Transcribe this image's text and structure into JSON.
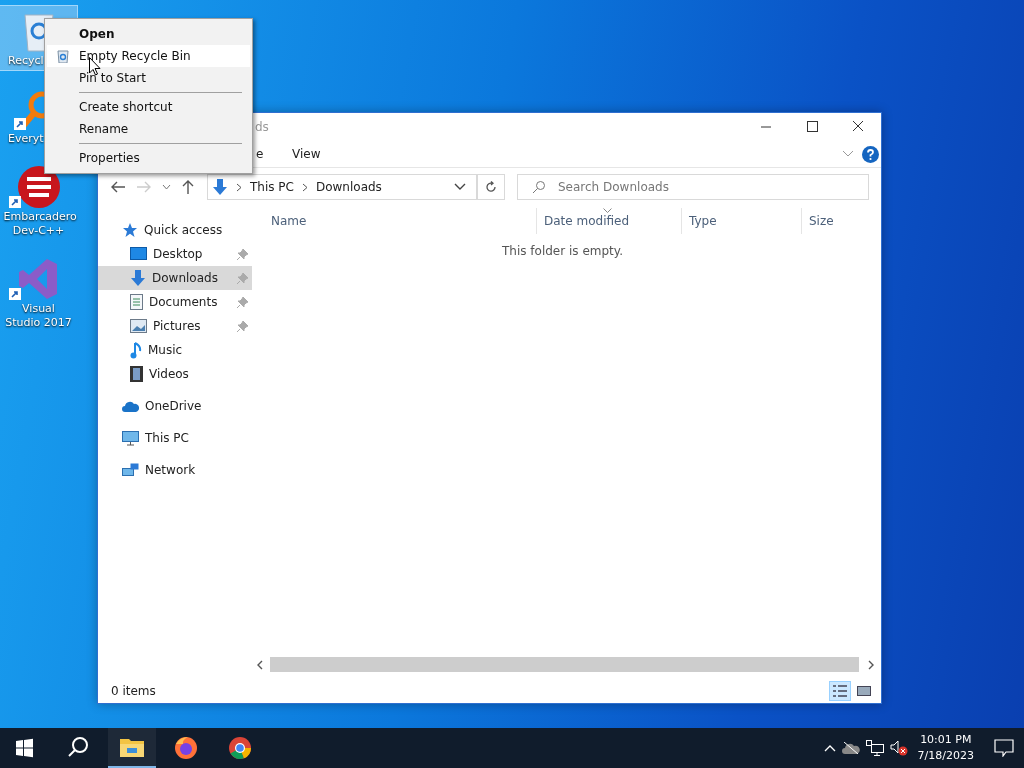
{
  "desktop_icons": [
    {
      "kind": "recycle",
      "label": "Recycl",
      "selected": true,
      "shortcut": false
    },
    {
      "kind": "search",
      "label": "Everyt",
      "selected": false,
      "shortcut": true
    },
    {
      "kind": "devcpp",
      "label": "Embarcadero Dev-C++",
      "selected": false,
      "shortcut": true
    },
    {
      "kind": "vs",
      "label": "Visual Studio 2017",
      "selected": false,
      "shortcut": true
    }
  ],
  "context_menu": {
    "items": [
      {
        "kind": "item",
        "label": "Open",
        "default": true,
        "highlighted": false
      },
      {
        "kind": "icon_item",
        "label": "Empty Recycle Bin",
        "default": false,
        "highlighted": true
      },
      {
        "kind": "item",
        "label": "Pin to Start",
        "default": false,
        "highlighted": false
      },
      {
        "kind": "separator"
      },
      {
        "kind": "item",
        "label": "Create shortcut",
        "default": false,
        "highlighted": false
      },
      {
        "kind": "item",
        "label": "Rename",
        "default": false,
        "highlighted": false
      },
      {
        "kind": "separator"
      },
      {
        "kind": "item",
        "label": "Properties",
        "default": false,
        "highlighted": false
      }
    ]
  },
  "explorer": {
    "title": "ds",
    "ribbon_tabs": [
      {
        "label": "e",
        "selected": false
      },
      {
        "label": "View",
        "selected": false
      }
    ],
    "address": {
      "path": [
        {
          "label": "This PC"
        },
        {
          "label": "Downloads"
        }
      ]
    },
    "search": {
      "placeholder": "Search Downloads"
    },
    "sidebar": {
      "items": [
        {
          "kind": "star",
          "label": "Quick access",
          "selected": false,
          "children": [
            {
              "kind": "desktop",
              "label": "Desktop",
              "selected": false,
              "pinned": true
            },
            {
              "kind": "download",
              "label": "Downloads",
              "selected": true,
              "pinned": true
            },
            {
              "kind": "document",
              "label": "Documents",
              "selected": false,
              "pinned": true
            },
            {
              "kind": "picture",
              "label": "Pictures",
              "selected": false,
              "pinned": true
            },
            {
              "kind": "music",
              "label": "Music",
              "selected": false,
              "pinned": false
            },
            {
              "kind": "video",
              "label": "Videos",
              "selected": false,
              "pinned": false
            }
          ]
        },
        {
          "kind": "cloud",
          "label": "OneDrive",
          "selected": false
        },
        {
          "kind": "pc",
          "label": "This PC",
          "selected": false
        },
        {
          "kind": "network",
          "label": "Network",
          "selected": false
        }
      ]
    },
    "table": {
      "columns": [
        {
          "label": "Name",
          "sorted": false
        },
        {
          "label": "Date modified",
          "sorted": true
        },
        {
          "label": "Type",
          "sorted": false
        },
        {
          "label": "Size",
          "sorted": false
        }
      ],
      "empty_message": "This folder is empty."
    },
    "status_bar": {
      "item_count": "0 items",
      "views": [
        {
          "kind": "details",
          "selected": true
        },
        {
          "kind": "large",
          "selected": false
        }
      ]
    }
  },
  "taskbar": {
    "apps": [
      {
        "kind": "explorer",
        "running": true
      },
      {
        "kind": "firefox",
        "running": false
      },
      {
        "kind": "chrome",
        "running": false
      }
    ],
    "tray": {
      "volume_muted": true
    },
    "clock": {
      "time": "10:01 PM",
      "date": "7/18/2023"
    }
  }
}
